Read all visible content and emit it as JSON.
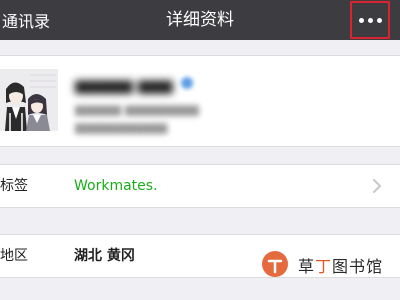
{
  "navbar": {
    "back_label": "通讯录",
    "title": "详细资料",
    "more_icon": "more-dots-icon",
    "highlight_color": "#d9242f"
  },
  "profile": {
    "avatar_icon": "manga-couple-avatar"
  },
  "rows": [
    {
      "label": "标签",
      "value": "Workmates.",
      "value_color": "#1aad19",
      "arrow_icon": "chevron-right-icon"
    },
    {
      "label": "地区",
      "value": "湖北 黄冈",
      "value_color": "#222222"
    }
  ],
  "watermark": {
    "text": "草丁图书馆",
    "highlight_char": "丁",
    "highlight_color": "#e15a2a"
  }
}
